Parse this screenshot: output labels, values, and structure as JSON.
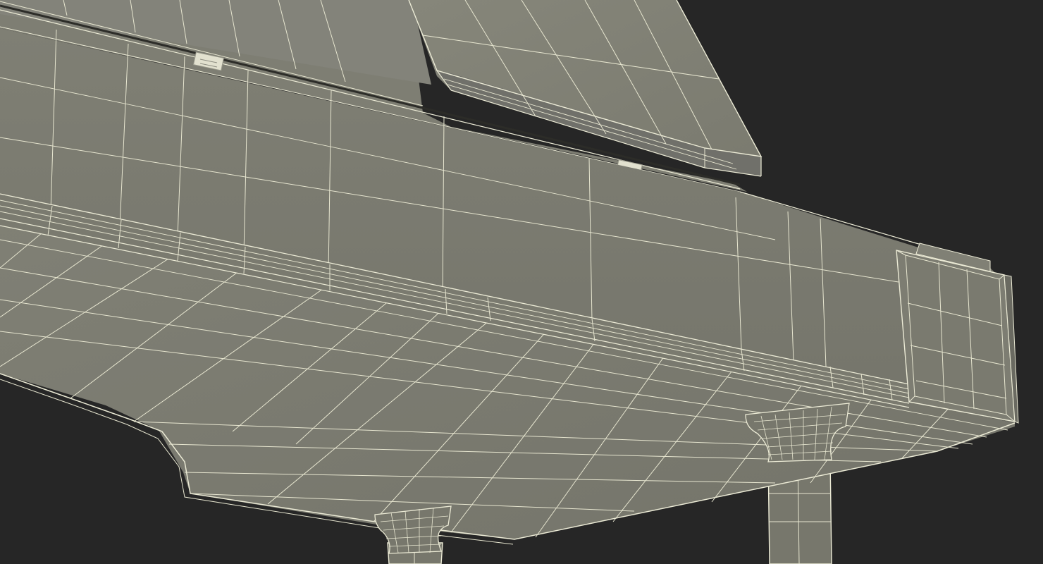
{
  "scene": {
    "subject": "grand-piano-wireframe-underside",
    "colors": {
      "background": "#262626",
      "surface": "#7b7b70",
      "surface_dark": "#6c6c62",
      "surface_light": "#86867b",
      "rim": "#84847a",
      "edge_line": "#ecebd6",
      "wire_line": "#e7e6d0",
      "shadow": "#3a3a36"
    }
  }
}
